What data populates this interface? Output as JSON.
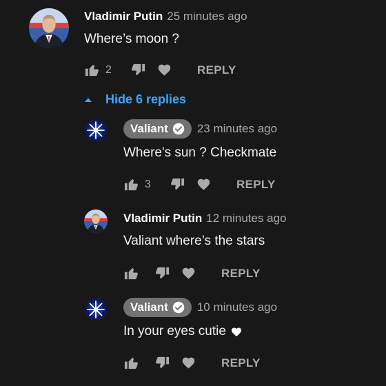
{
  "colors": {
    "background": "#181818",
    "link": "#3ea6ff",
    "muted": "#aaaaaa",
    "badge_bg": "#727272"
  },
  "thread": {
    "top_comment": {
      "author": "Vladimir Putin",
      "time": "25 minutes ago",
      "text": "Where’s moon ?",
      "likes": "2",
      "reply_label": "REPLY"
    },
    "toggle": {
      "label": "Hide 6 replies",
      "icon": "caret-up-icon"
    },
    "replies": [
      {
        "author": "Valiant",
        "verified_badge": true,
        "time": "23 minutes ago",
        "text": "Where's sun ? Checkmate",
        "likes": "3",
        "reply_label": "REPLY"
      },
      {
        "author": "Vladimir Putin",
        "verified_badge": false,
        "time": "12 minutes ago",
        "text": "Valiant where’s the stars",
        "likes": "",
        "reply_label": "REPLY"
      },
      {
        "author": "Valiant",
        "verified_badge": true,
        "time": "10 minutes ago",
        "text": "In your eyes cutie",
        "likes": "",
        "reply_label": "REPLY"
      }
    ]
  }
}
